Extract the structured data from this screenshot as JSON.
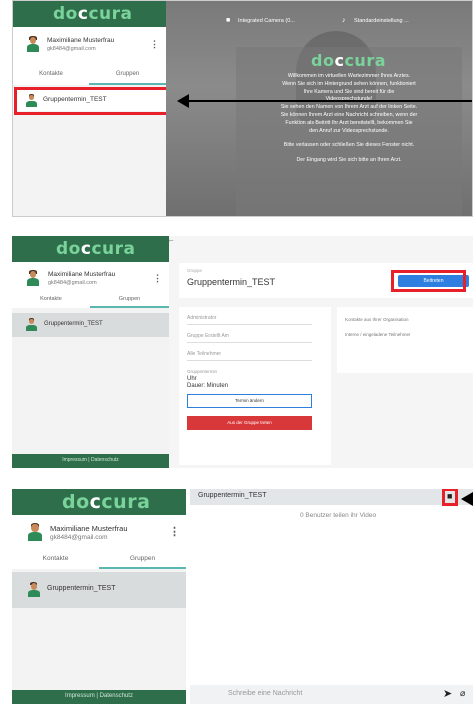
{
  "app": {
    "logo_prefix": "do",
    "logo_c": "c",
    "logo_suffix": "cura"
  },
  "user": {
    "name": "Maximiliane Musterfrau",
    "email": "gk8484@gmail.com"
  },
  "tabs": {
    "contacts": "Kontakte",
    "groups": "Gruppen"
  },
  "group": {
    "name": "Gruppentermin_TEST"
  },
  "panel1": {
    "camera_select": "Integrated Camera (0...",
    "mic_select": "Standardeinstellung ...",
    "overlay_text": [
      "Willkommen im virtuellen Wartezimmer Ihres Arztes.",
      "Wenn Sie sich im Hintergrund sehen können, funktioniert",
      "Ihre Kamera und Sie sind bereit für die",
      "Videosprechstunde!",
      "Sie sehen den Namen von Ihrem Arzt auf der linken Seite.",
      "Sie können Ihrem Arzt eine Nachricht schreiben, wenn der",
      "Funktion als Beitritt Ihr Arzt bereitstellt, bekommen Sie",
      "den Anruf zur Videosprechstunde.",
      "",
      "Bitte verlassen oder schließen Sie dieses Fenster nicht.",
      "",
      "Der Eingang wird Sie sich bitte an Ihren Arzt."
    ]
  },
  "panel2": {
    "back_arrow": "←",
    "group_label": "Gruppe",
    "join_button": "Beitreten",
    "fields": [
      "Administrator",
      "Gruppe Erstellt Am",
      "Alle Teilnehmer"
    ],
    "schedule_label": "Gruppentermin",
    "schedule_uhr": "Uhr",
    "schedule_dauer": "Dauer: Minuten",
    "change_button": "Termin ändern",
    "leave_button": "Aus der Gruppe treten",
    "right_title": "Kontakte aus Ihrer Organisation",
    "right_sub": "Interne / eingeladene Teilnehmer",
    "footer": "Impressum | Datenschutz"
  },
  "panel3": {
    "header_title": "Gruppentermin_TEST",
    "video_status": "0 Benutzer teilen ihr Video",
    "message_placeholder": "Schreibe eine Nachricht",
    "footer": "Impressum | Datenschutz"
  },
  "colors": {
    "brand_green": "#2f6e4b",
    "logo_green": "#79d39a",
    "highlight_red": "#e8202a",
    "join_blue": "#2f7fe0",
    "leave_red": "#d9383a"
  }
}
